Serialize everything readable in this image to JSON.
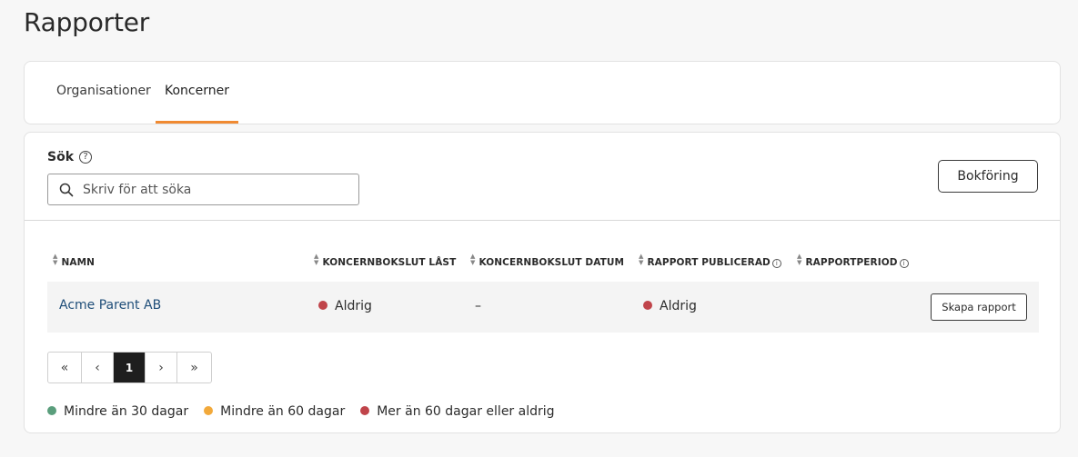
{
  "page": {
    "title": "Rapporter"
  },
  "tabs": [
    {
      "label": "Organisationer",
      "active": false
    },
    {
      "label": "Koncerner",
      "active": true
    }
  ],
  "search": {
    "label": "Sök",
    "placeholder": "Skriv för att söka",
    "value": ""
  },
  "actions": {
    "bokforing_label": "Bokföring"
  },
  "table": {
    "columns": [
      "NAMN",
      "KONCERNBOKSLUT LÅST",
      "KONCERNBOKSLUT DATUM",
      "RAPPORT PUBLICERAD",
      "RAPPORTPERIOD"
    ],
    "rows": [
      {
        "name": "Acme Parent AB",
        "locked": {
          "text": "Aldrig",
          "status_color": "#c0444a"
        },
        "date": "–",
        "published": {
          "text": "Aldrig",
          "status_color": "#c0444a"
        },
        "period": "",
        "action_label": "Skapa rapport"
      }
    ]
  },
  "pagination": {
    "first": "«",
    "prev": "‹",
    "current": "1",
    "next": "›",
    "last": "»"
  },
  "legend": [
    {
      "label": "Mindre än 30 dagar",
      "color": "#5a9e7c"
    },
    {
      "label": "Mindre än 60 dagar",
      "color": "#f2a93b"
    },
    {
      "label": "Mer än 60 dagar eller aldrig",
      "color": "#c0444a"
    }
  ],
  "colors": {
    "tab_active_underline": "#f08a32",
    "link": "#1f4e79"
  },
  "icons": {
    "help": "question-circle-icon",
    "search": "magnifier-icon",
    "sort": "sort-arrows-icon",
    "info": "info-circle-icon"
  }
}
